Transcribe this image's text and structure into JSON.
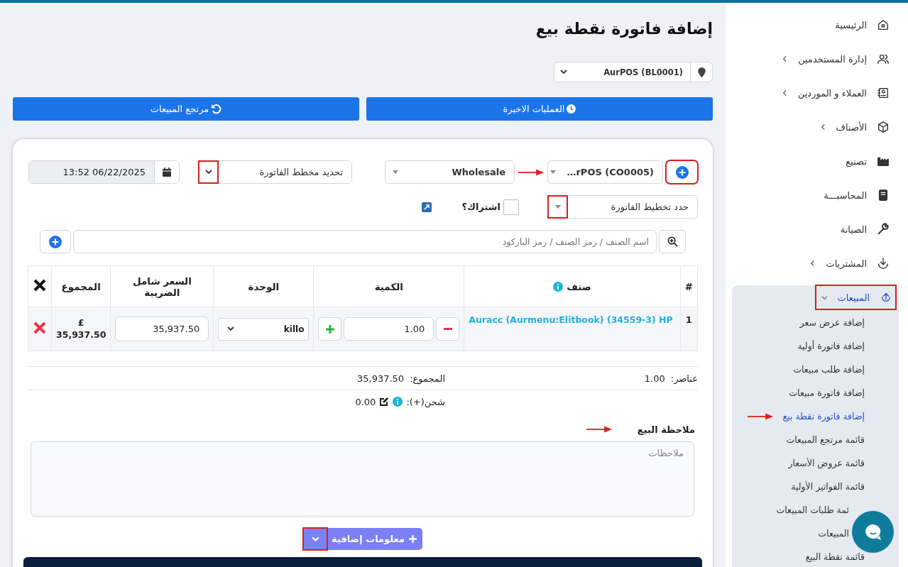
{
  "page_title": "إضافة فاتورة نقطة بيع",
  "location": {
    "value": "AurPOS (BL0001)"
  },
  "actions": [
    {
      "label": "العمليات الاخيرة"
    },
    {
      "label": "مرتجع المبيعات"
    }
  ],
  "customer": {
    "value": "…rPOS (CO0005)",
    "add_highlighted": true,
    "arrow": true
  },
  "price_group": {
    "value": "Wholesale"
  },
  "invoice_scheme": {
    "value": "تحديد مخطط الفاتورة",
    "chevron_highlighted": true
  },
  "date": {
    "value": "13:52 06/22/2025"
  },
  "invoice_layout": {
    "value": "حدد تخطيط الفاتورة",
    "chevron_highlighted": true
  },
  "subscription": {
    "label": "اشتراك؟",
    "checked": false
  },
  "search": {
    "placeholder": "اسم الصنف / رمز الصنف / رمز الباركود"
  },
  "table": {
    "columns": [
      "#",
      "صنف",
      "الكمية",
      "الوحدة",
      "السعر شامل الضريبة",
      "المجموع"
    ],
    "rows": [
      {
        "index": "1",
        "item": "Auracc (Aurmenu:Elitbook) (34559-3) HP",
        "quantity": "1.00",
        "unit": "killo",
        "price": "35,937.50",
        "currency": "£",
        "total": "35,937.50"
      }
    ]
  },
  "summary": {
    "items_label": "عناصر:",
    "items_value": "1.00",
    "total_label": "المجموع:",
    "total_value": "35,937.50",
    "shipping_label": "شحن(+):",
    "shipping_value": "0.00"
  },
  "note": {
    "label": "ملاحظة البيع",
    "placeholder": "ملاحظات",
    "arrow": true
  },
  "more_info": {
    "label": "معلومات إضافية",
    "chevron_highlighted": true
  },
  "sidebar": {
    "items": [
      {
        "label": "الرئيسية",
        "has_submenu": false,
        "selected": false
      },
      {
        "label": "إدارة المستخدمين",
        "has_submenu": true,
        "selected": false
      },
      {
        "label": "العملاء و الموردين",
        "has_submenu": true,
        "selected": false
      },
      {
        "label": "الأصناف",
        "has_submenu": true,
        "selected": false
      },
      {
        "label": "تصنيع",
        "has_submenu": false,
        "selected": false
      },
      {
        "label": "المحاسبـــة",
        "has_submenu": false,
        "selected": false
      },
      {
        "label": "الصيانة",
        "has_submenu": false,
        "selected": false
      },
      {
        "label": "المشتريات",
        "has_submenu": true,
        "selected": false
      },
      {
        "label": "المبيعات",
        "has_submenu": true,
        "selected": true,
        "expanded": true,
        "highlighted": true,
        "children": [
          {
            "label": "إضافة عرض سعر",
            "selected": false,
            "arrow": false
          },
          {
            "label": "إضافة فاتورة أولية",
            "selected": false,
            "arrow": false
          },
          {
            "label": "إضافة طلب مبيعات",
            "selected": false,
            "arrow": false
          },
          {
            "label": "إضافة فاتورة مبيعات",
            "selected": false,
            "arrow": false
          },
          {
            "label": "إضافة فاتورة نقطة بيع",
            "selected": true,
            "arrow": true
          },
          {
            "label": "قائمة مرتجع المبيعات",
            "selected": false,
            "arrow": false
          },
          {
            "label": "قائمة عروض الأسعار",
            "selected": false,
            "arrow": false
          },
          {
            "label": "قائمة الفواتير الأولية",
            "selected": false,
            "arrow": false
          },
          {
            "label": "ئمة طلبات المبيعات",
            "selected": false,
            "arrow": false,
            "covered": true
          },
          {
            "label": "المبيعات",
            "selected": false,
            "arrow": false,
            "covered": true
          },
          {
            "label": "قائمة نقطة البيع",
            "selected": false,
            "arrow": false
          }
        ]
      }
    ]
  }
}
